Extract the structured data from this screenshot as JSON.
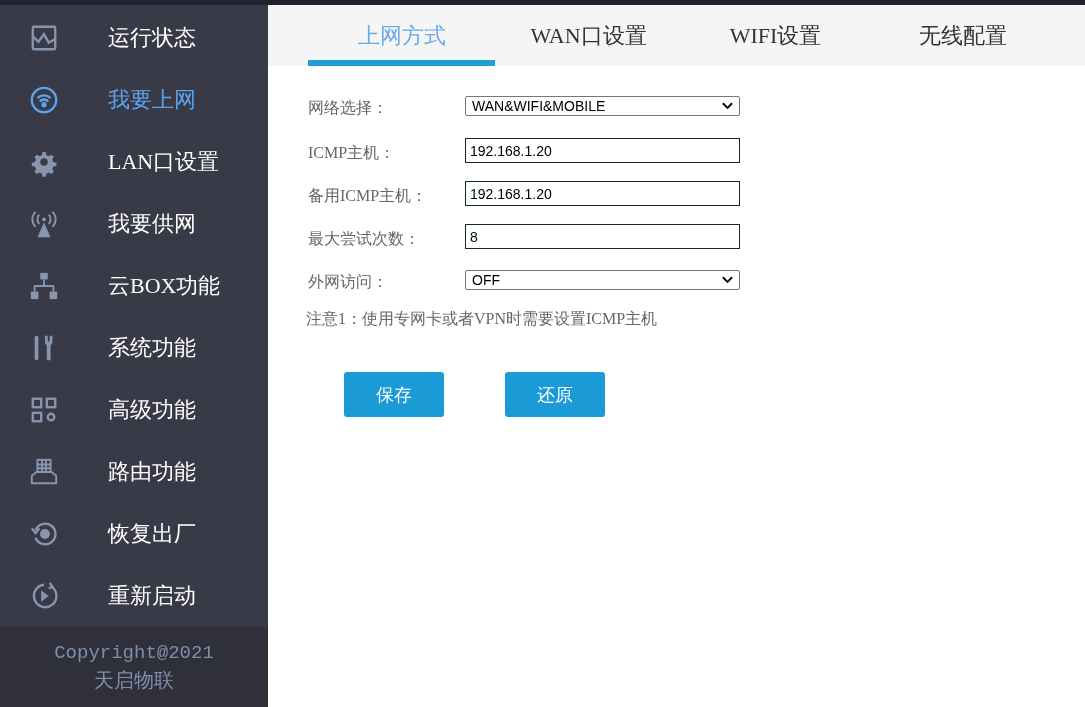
{
  "sidebar": {
    "items": [
      {
        "label": "运行状态",
        "selected": false
      },
      {
        "label": "我要上网",
        "selected": true
      },
      {
        "label": "LAN口设置",
        "selected": false
      },
      {
        "label": "我要供网",
        "selected": false
      },
      {
        "label": "云BOX功能",
        "selected": false
      },
      {
        "label": "系统功能",
        "selected": false
      },
      {
        "label": "高级功能",
        "selected": false
      },
      {
        "label": "路由功能",
        "selected": false
      },
      {
        "label": "恢复出厂",
        "selected": false
      },
      {
        "label": "重新启动",
        "selected": false
      }
    ],
    "footer": [
      "Copyright@2021",
      "天启物联"
    ]
  },
  "tabs": [
    {
      "label": "上网方式",
      "selected": true
    },
    {
      "label": "WAN口设置",
      "selected": false
    },
    {
      "label": "WIFI设置",
      "selected": false
    },
    {
      "label": "无线配置",
      "selected": false
    }
  ],
  "form": {
    "fields": [
      {
        "kind": "select",
        "label": "网络选择：",
        "value": "WAN&WIFI&MOBILE"
      },
      {
        "kind": "input",
        "label": "ICMP主机：",
        "value": "192.168.1.20"
      },
      {
        "kind": "input",
        "label": "备用ICMP主机：",
        "value": "192.168.1.20"
      },
      {
        "kind": "input",
        "label": "最大尝试次数：",
        "value": "8"
      },
      {
        "kind": "select",
        "label": "外网访问：",
        "value": "OFF"
      }
    ],
    "note": "注意1：使用专网卡或者VPN时需要设置ICMP主机",
    "buttons": [
      "保存",
      "还原"
    ]
  }
}
